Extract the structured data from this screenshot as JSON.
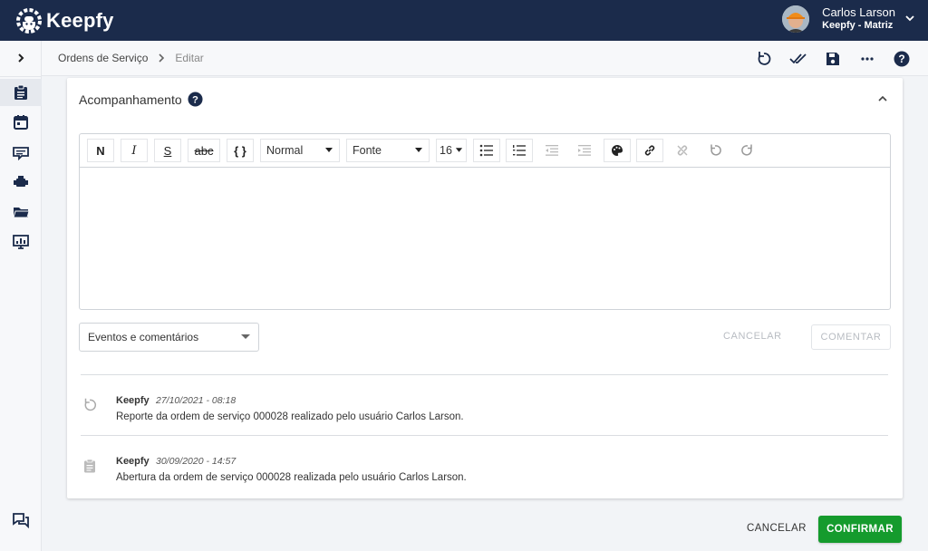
{
  "header": {
    "brand": "Keepfy",
    "user_name": "Carlos Larson",
    "user_company": "Keepfy - Matriz"
  },
  "sidebar": {
    "items": [
      {
        "icon": "clipboard-icon",
        "active": true
      },
      {
        "icon": "calendar-icon",
        "active": false
      },
      {
        "icon": "ticket-icon",
        "active": false
      },
      {
        "icon": "engine-icon",
        "active": false
      },
      {
        "icon": "folder-icon",
        "active": false
      },
      {
        "icon": "dashboard-icon",
        "active": false
      }
    ]
  },
  "breadcrumb": {
    "parent": "Ordens de Serviço",
    "current": "Editar"
  },
  "card": {
    "title": "Acompanhamento"
  },
  "editor": {
    "bold": "N",
    "italic": "I",
    "underline": "S",
    "strike": "abc",
    "code": "{ }",
    "format_value": "Normal",
    "font_value": "Fonte",
    "size_value": "16"
  },
  "events": {
    "filter_value": "Eventos e comentários",
    "cancel_label": "CANCELAR",
    "comment_label": "COMENTAR",
    "items": [
      {
        "icon": "undo-icon",
        "author": "Keepfy",
        "time": "27/10/2021 - 08:18",
        "text": "Reporte da ordem de serviço 000028 realizado pelo usuário Carlos Larson."
      },
      {
        "icon": "clipboard-icon",
        "author": "Keepfy",
        "time": "30/09/2020 - 14:57",
        "text": "Abertura da ordem de serviço 000028 realizada pelo usuário Carlos Larson."
      }
    ]
  },
  "footer": {
    "cancel_label": "CANCELAR",
    "confirm_label": "CONFIRMAR"
  },
  "colors": {
    "header_bg": "#1b2b4b",
    "confirm_green": "#159b2d"
  }
}
